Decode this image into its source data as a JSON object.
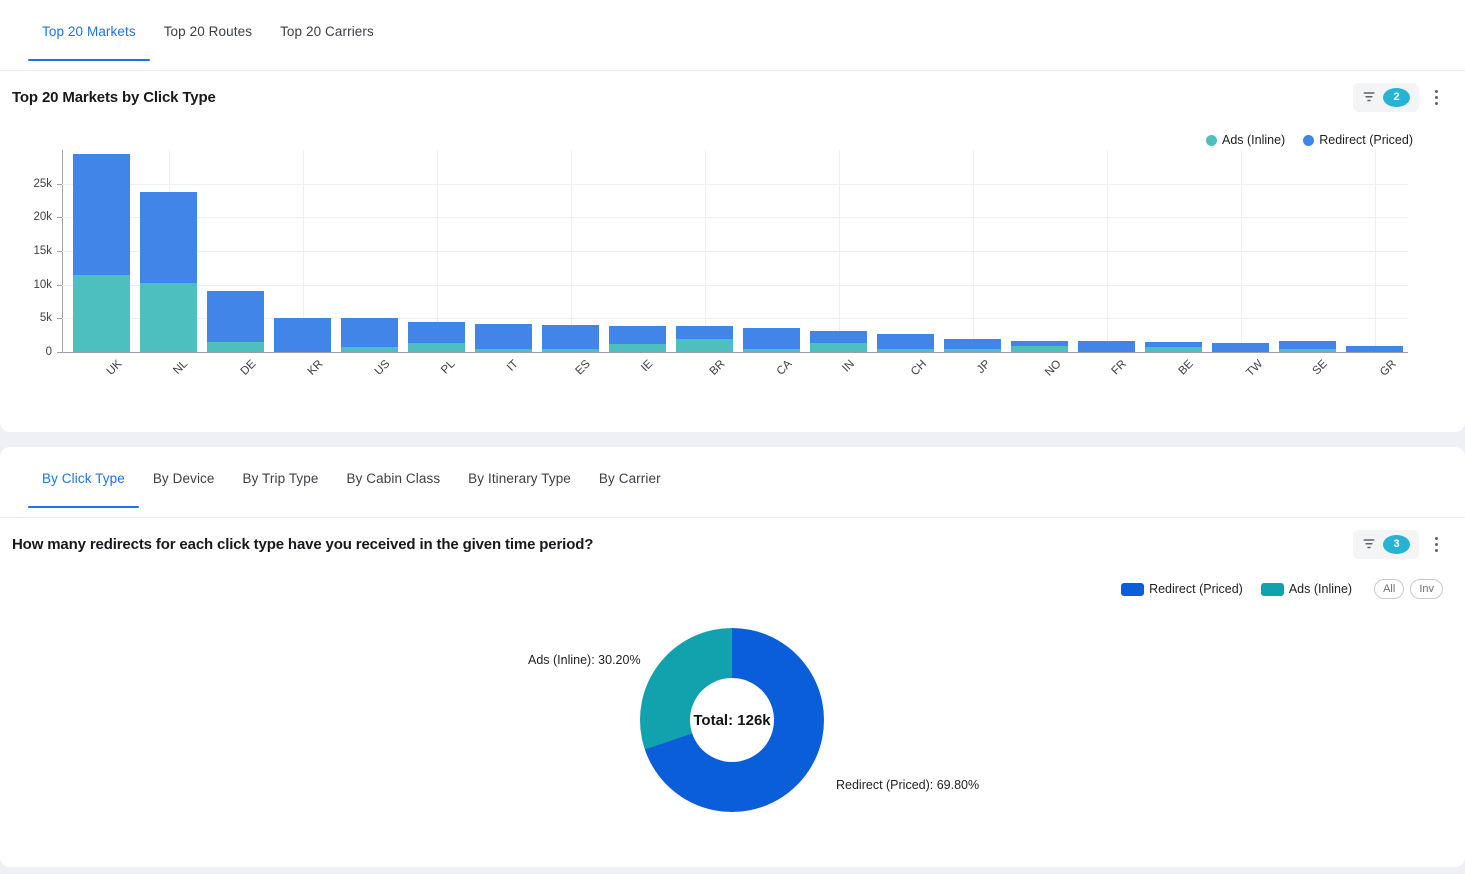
{
  "top_panel": {
    "tabs": [
      {
        "label": "Top 20 Markets",
        "active": true
      },
      {
        "label": "Top 20 Routes",
        "active": false
      },
      {
        "label": "Top 20 Carriers",
        "active": false
      }
    ],
    "title": "Top 20 Markets by Click Type",
    "filter_badge": "2",
    "filter_icon": "funnel-icon",
    "menu_icon": "kebab-menu-icon"
  },
  "bottom_panel": {
    "tabs": [
      {
        "label": "By Click Type",
        "active": true
      },
      {
        "label": "By Device",
        "active": false
      },
      {
        "label": "By Trip Type",
        "active": false
      },
      {
        "label": "By Cabin Class",
        "active": false
      },
      {
        "label": "By Itinerary Type",
        "active": false
      },
      {
        "label": "By Carrier",
        "active": false
      }
    ],
    "title": "How many redirects for each click type have you received in the given time period?",
    "filter_badge": "3",
    "filter_icon": "funnel-icon",
    "menu_icon": "kebab-menu-icon",
    "pills": [
      {
        "label": "All"
      },
      {
        "label": "Inv"
      }
    ]
  },
  "colors": {
    "bar_blue": "#4285e8",
    "bar_teal": "#4ebfbf",
    "donut_blue": "#0a5ed9",
    "donut_teal": "#12a2ad",
    "accent": "#1a73e8",
    "badge": "#27b4d4"
  },
  "chart_data": [
    {
      "type": "bar",
      "title": "Top 20 Markets by Click Type",
      "stacked": true,
      "xlabel": "",
      "ylabel": "",
      "ylim": [
        0,
        30000
      ],
      "yticks": [
        0,
        5000,
        10000,
        15000,
        20000,
        25000
      ],
      "ytick_labels": [
        "0",
        "5k",
        "10k",
        "15k",
        "20k",
        "25k"
      ],
      "grid": true,
      "legend_position": "top-right",
      "categories": [
        "UK",
        "NL",
        "DE",
        "KR",
        "US",
        "PL",
        "IT",
        "ES",
        "IE",
        "BR",
        "CA",
        "IN",
        "CH",
        "JP",
        "NO",
        "FR",
        "BE",
        "TW",
        "SE",
        "GR"
      ],
      "series": [
        {
          "name": "Ads (Inline)",
          "color": "#4ebfbf",
          "values": [
            11400,
            10300,
            1500,
            0,
            700,
            1400,
            400,
            400,
            1200,
            1900,
            400,
            1400,
            500,
            400,
            900,
            0,
            700,
            0,
            500,
            0
          ]
        },
        {
          "name": "Redirect (Priced)",
          "color": "#4285e8",
          "values": [
            18000,
            13500,
            7500,
            5000,
            4300,
            3100,
            3700,
            3600,
            2600,
            1900,
            3200,
            1700,
            2200,
            1600,
            700,
            1600,
            800,
            1300,
            1100,
            900
          ]
        }
      ]
    },
    {
      "type": "pie",
      "variant": "donut",
      "title": "How many redirects for each click type have you received in the given time period?",
      "center_label": "Total: 126k",
      "legend_position": "top-right",
      "slices": [
        {
          "name": "Redirect (Priced)",
          "percent": 69.8,
          "label": "Redirect (Priced): 69.80%",
          "color": "#0a5ed9"
        },
        {
          "name": "Ads (Inline)",
          "percent": 30.2,
          "label": "Ads (Inline): 30.20%",
          "color": "#12a2ad"
        }
      ]
    }
  ]
}
